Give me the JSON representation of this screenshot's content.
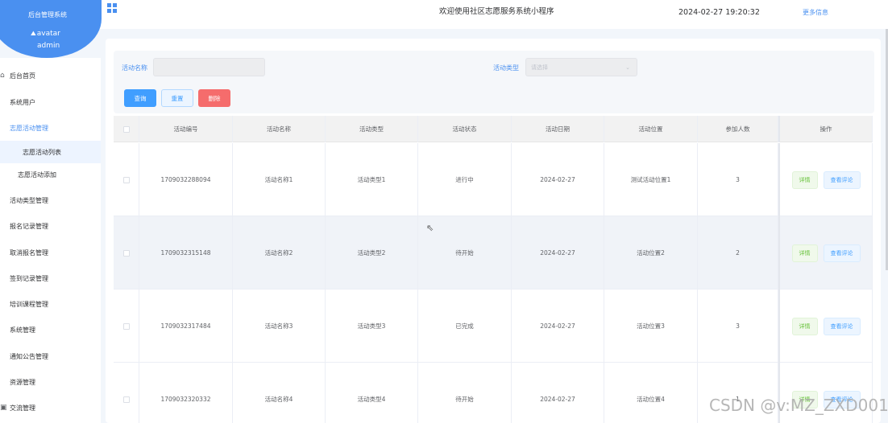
{
  "header": {
    "brand": "后台管理系统",
    "avatar_alt": "avatar",
    "user": "admin",
    "welcome": "欢迎使用社区志愿服务系统小程序",
    "datetime": "2024-02-27 19:20:32",
    "more_info": "更多信息",
    "brand_color": "#4a90f0"
  },
  "sidebar": {
    "items": [
      {
        "label": "后台首页",
        "icon": "home-icon"
      },
      {
        "label": "系统用户"
      },
      {
        "label": "志愿活动管理"
      },
      {
        "label": "志愿活动列表"
      },
      {
        "label": "志愿活动添加"
      },
      {
        "label": "活动类型管理"
      },
      {
        "label": "报名记录管理"
      },
      {
        "label": "取消报名管理"
      },
      {
        "label": "签到记录管理"
      },
      {
        "label": "培训课程管理"
      },
      {
        "label": "系统管理"
      },
      {
        "label": "通知公告管理"
      },
      {
        "label": "资源管理"
      },
      {
        "label": "交流管理",
        "icon": "chat-icon"
      }
    ]
  },
  "filters": {
    "name_label": "活动名称",
    "name_value": "",
    "type_label": "活动类型",
    "type_placeholder": "请选择",
    "search_btn": "查询",
    "reset_btn": "重置",
    "delete_btn": "删除"
  },
  "table": {
    "columns": [
      "活动编号",
      "活动名称",
      "活动类型",
      "活动状态",
      "活动日期",
      "活动位置",
      "参加人数",
      "操作"
    ],
    "rows": [
      {
        "id": "1709032288094",
        "name": "活动名称1",
        "type": "活动类型1",
        "status": "进行中",
        "date": "2024-02-27",
        "location": "测试活动位置1",
        "count": "3"
      },
      {
        "id": "1709032315148",
        "name": "活动名称2",
        "type": "活动类型2",
        "status": "待开始",
        "date": "2024-02-27",
        "location": "活动位置2",
        "count": "2"
      },
      {
        "id": "1709032317484",
        "name": "活动名称3",
        "type": "活动类型3",
        "status": "已完成",
        "date": "2024-02-27",
        "location": "活动位置3",
        "count": "3"
      },
      {
        "id": "1709032320332",
        "name": "活动名称4",
        "type": "活动类型4",
        "status": "待开始",
        "date": "2024-02-27",
        "location": "活动位置4",
        "count": "1"
      }
    ],
    "detail_btn": "详情",
    "review_btn": "查看评论"
  },
  "watermark": "CSDN @v:MZ_ZXD001"
}
